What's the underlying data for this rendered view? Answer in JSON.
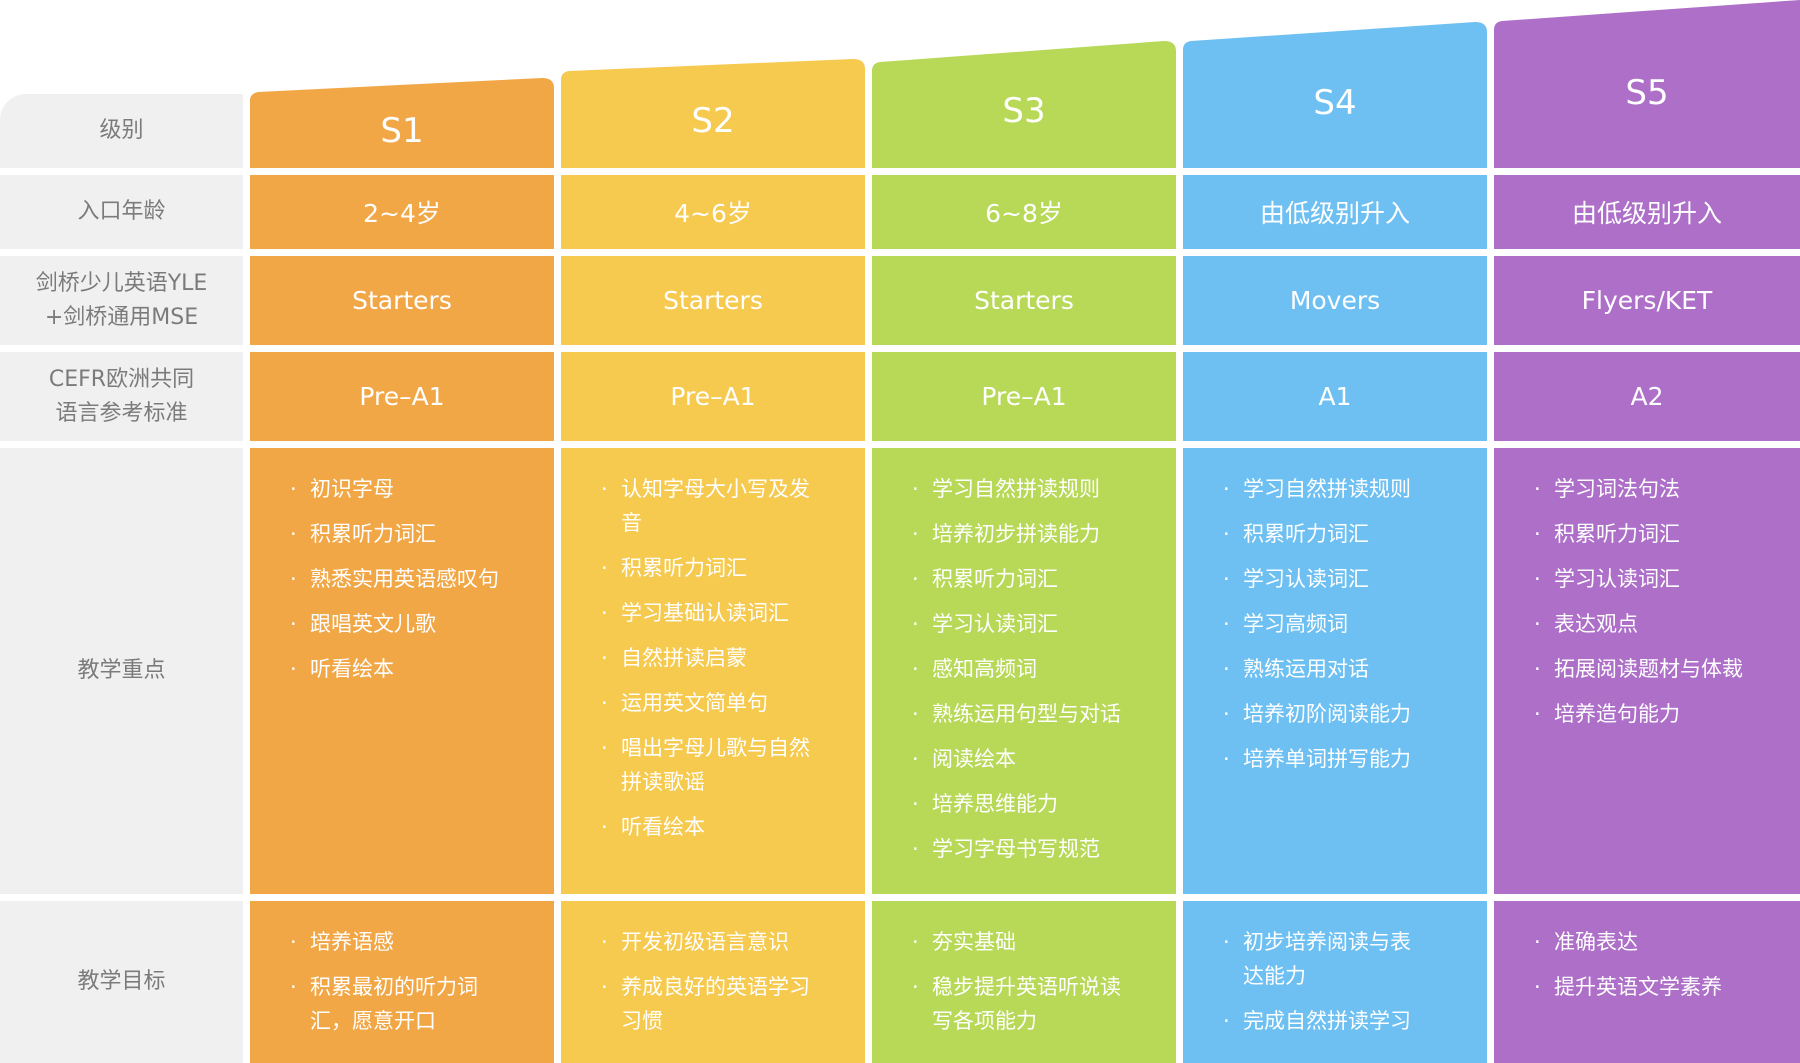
{
  "labels": {
    "level": "级别",
    "age": "入口年龄",
    "exam_line1": "剑桥少儿英语YLE",
    "exam_line2": "+剑桥通用MSE",
    "cefr_line1": "CEFR欧洲共同",
    "cefr_line2": "语言参考标准",
    "focus": "教学重点",
    "goal": "教学目标"
  },
  "levels": [
    {
      "name": "S1",
      "color": "#f2a747",
      "age": "2~4岁",
      "exam": "Starters",
      "cefr": "Pre–A1",
      "focus": [
        "初识字母",
        "积累听力词汇",
        "熟悉实用英语感叹句",
        "跟唱英文儿歌",
        "听看绘本"
      ],
      "goals": [
        "培养语感",
        "积累最初的听力词汇，愿意开口"
      ]
    },
    {
      "name": "S2",
      "color": "#f6c94f",
      "age": "4~6岁",
      "exam": "Starters",
      "cefr": "Pre–A1",
      "focus": [
        "认知字母大小写及发音",
        "积累听力词汇",
        "学习基础认读词汇",
        "自然拼读启蒙",
        "运用英文简单句",
        "唱出字母儿歌与自然拼读歌谣",
        "听看绘本"
      ],
      "goals": [
        "开发初级语言意识",
        "养成良好的英语学习习惯"
      ]
    },
    {
      "name": "S3",
      "color": "#b7d957",
      "age": "6~8岁",
      "exam": "Starters",
      "cefr": "Pre–A1",
      "focus": [
        "学习自然拼读规则",
        "培养初步拼读能力",
        "积累听力词汇",
        "学习认读词汇",
        "感知高频词",
        "熟练运用句型与对话",
        "阅读绘本",
        "培养思维能力",
        "学习字母书写规范"
      ],
      "goals": [
        "夯实基础",
        "稳步提升英语听说读写各项能力"
      ]
    },
    {
      "name": "S4",
      "color": "#6ec0f2",
      "age": "由低级别升入",
      "exam": "Movers",
      "cefr": "A1",
      "focus": [
        "学习自然拼读规则",
        "积累听力词汇",
        "学习认读词汇",
        "学习高频词",
        "熟练运用对话",
        "培养初阶阅读能力",
        "培养单词拼写能力"
      ],
      "goals": [
        "初步培养阅读与表达能力",
        "完成自然拼读学习"
      ]
    },
    {
      "name": "S5",
      "color": "#ad6fc8",
      "age": "由低级别升入",
      "exam": "Flyers/KET",
      "cefr": "A2",
      "focus": [
        "学习词法句法",
        "积累听力词汇",
        "学习认读词汇",
        "表达观点",
        "拓展阅读题材与体裁",
        "培养造句能力"
      ],
      "goals": [
        "准确表达",
        "提升英语文学素养"
      ]
    }
  ]
}
